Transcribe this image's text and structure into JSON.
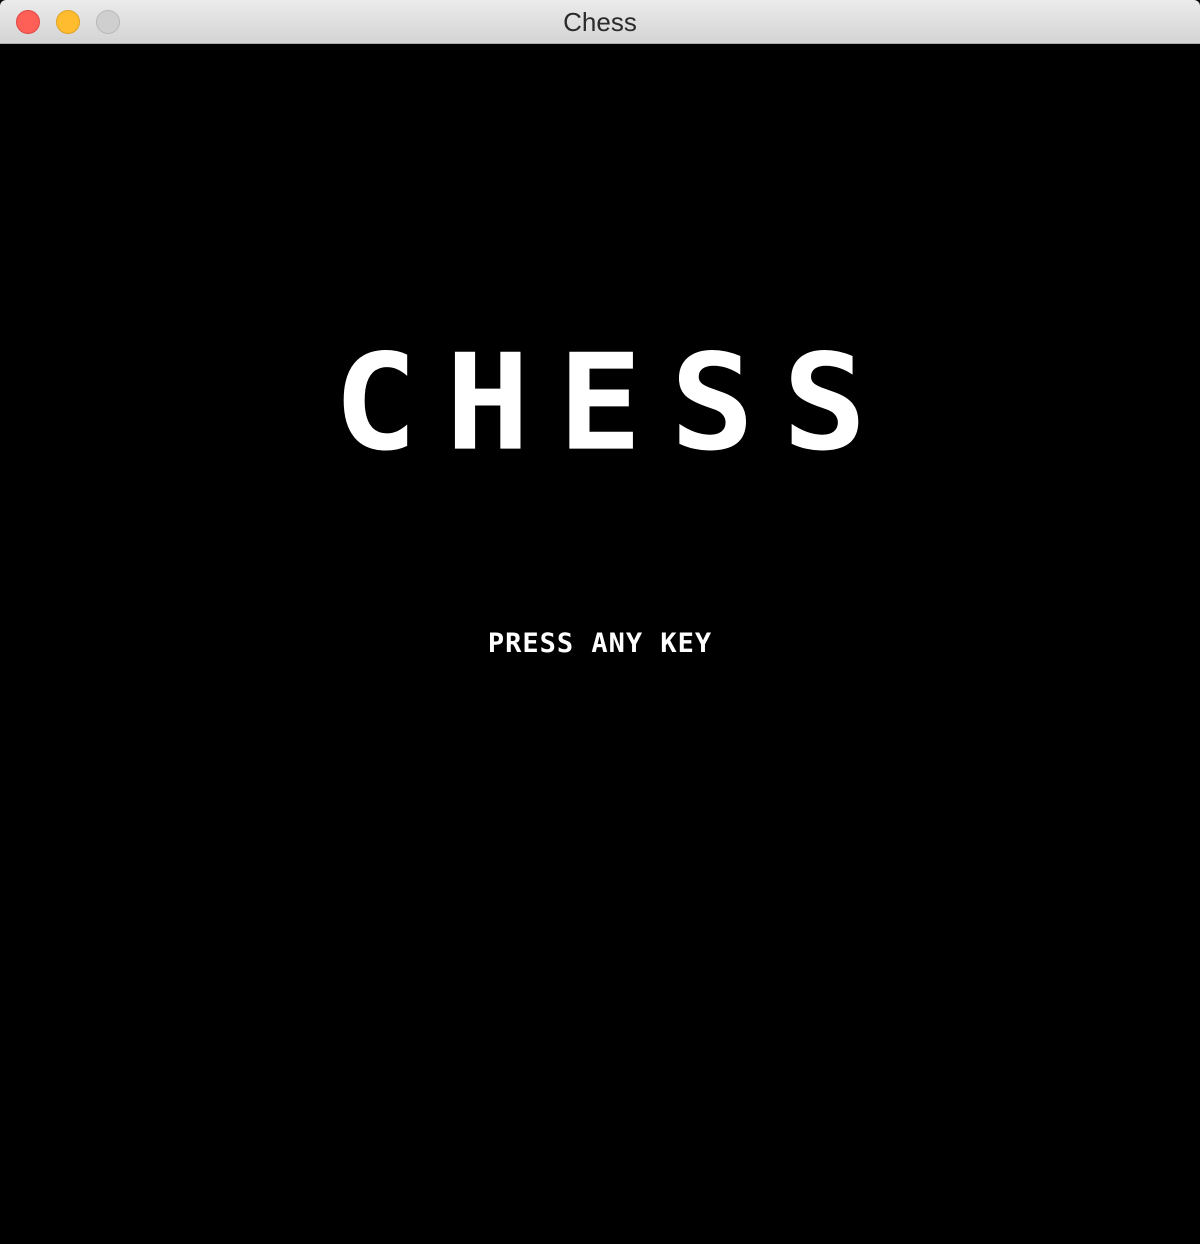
{
  "window": {
    "title": "Chess",
    "controls": {
      "close": "close-button",
      "minimize": "minimize-button",
      "zoom": "zoom-button"
    },
    "colors": {
      "close": "#fe5f57",
      "minimize": "#febc2e",
      "zoom_disabled": "#d0cfd0",
      "background": "#000000"
    }
  },
  "game": {
    "title": "CHESS",
    "prompt": "PRESS ANY KEY",
    "text_color": "#ffffff"
  }
}
